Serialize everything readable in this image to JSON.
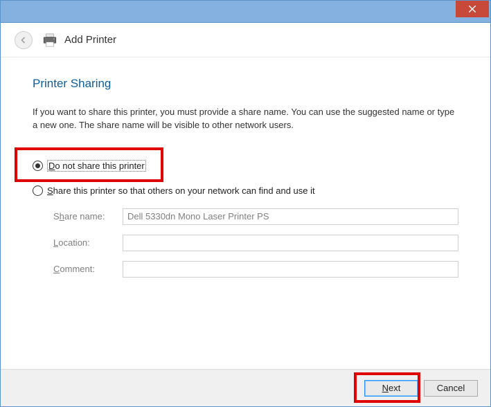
{
  "titlebar": {
    "close": "✕"
  },
  "header": {
    "title": "Add Printer"
  },
  "content": {
    "section_title": "Printer Sharing",
    "description": "If you want to share this printer, you must provide a share name. You can use the suggested name or type a new one. The share name will be visible to other network users.",
    "radio_noshare": "Do not share this printer",
    "radio_share": "Share this printer so that others on your network can find and use it",
    "fields": {
      "share_name_label": "Share name:",
      "share_name_value": "Dell 5330dn Mono Laser Printer PS",
      "location_label": "Location:",
      "location_value": "",
      "comment_label": "Comment:",
      "comment_value": ""
    }
  },
  "footer": {
    "next": "Next",
    "cancel": "Cancel"
  }
}
